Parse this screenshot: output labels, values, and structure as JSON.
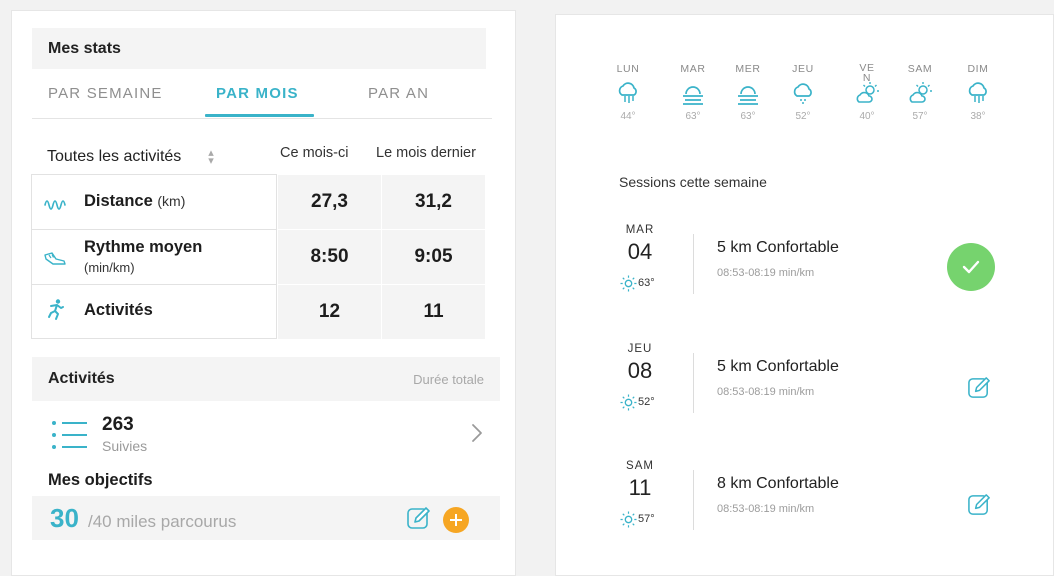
{
  "stats": {
    "header": "Mes stats",
    "tabs": [
      "PAR SEMAINE",
      "PAR MOIS",
      "PAR AN"
    ],
    "active_tab": "PAR MOIS",
    "filter_label": "Toutes les activités",
    "col_this": "Ce mois-ci",
    "col_last": "Le mois dernier",
    "rows": [
      {
        "label": "Distance",
        "unit": "(km)",
        "sub": "",
        "this": "27,3",
        "last": "31,2",
        "icon": "route-icon"
      },
      {
        "label": "Rythme moyen",
        "unit": "",
        "sub": "(min/km)",
        "this": "8:50",
        "last": "9:05",
        "icon": "shoe-icon"
      },
      {
        "label": "Activités",
        "unit": "",
        "sub": "",
        "this": "12",
        "last": "11",
        "icon": "runner-icon"
      }
    ]
  },
  "activities": {
    "header": "Activités",
    "duration_label": "Durée totale",
    "count": "263",
    "count_label": "Suivies"
  },
  "goals": {
    "title": "Mes objectifs",
    "current": "30",
    "rest": "/40 miles parcourus"
  },
  "forecast": [
    {
      "day": "LUN",
      "icon": "rain-icon",
      "temp": "44°"
    },
    {
      "day": "MAR",
      "icon": "fog-icon",
      "temp": "63°"
    },
    {
      "day": "MER",
      "icon": "fog-icon",
      "temp": "63°"
    },
    {
      "day": "JEU",
      "icon": "snow-cloud-icon",
      "temp": "52°"
    },
    {
      "day": "VE\nN",
      "icon": "partly-cloudy-icon",
      "temp": "40°"
    },
    {
      "day": "SAM",
      "icon": "partly-cloudy-icon",
      "temp": "57°"
    },
    {
      "day": "DIM",
      "icon": "rain-icon",
      "temp": "38°"
    }
  ],
  "sessions_title": "Sessions cette semaine",
  "sessions": [
    {
      "dow": "MAR",
      "day": "04",
      "temp": "63°",
      "name": "5 km Confortable",
      "pace": "08:53-08:19 min/km",
      "status": "done"
    },
    {
      "dow": "JEU",
      "day": "08",
      "temp": "52°",
      "name": "5 km Confortable",
      "pace": "08:53-08:19 min/km",
      "status": "edit"
    },
    {
      "dow": "SAM",
      "day": "11",
      "temp": "57°",
      "name": "8 km Confortable",
      "pace": "08:53-08:19 min/km",
      "status": "edit"
    }
  ],
  "colors": {
    "accent": "#3ab3c9",
    "done": "#76d36e",
    "add": "#f6a623",
    "panel": "#f4f4f4"
  }
}
